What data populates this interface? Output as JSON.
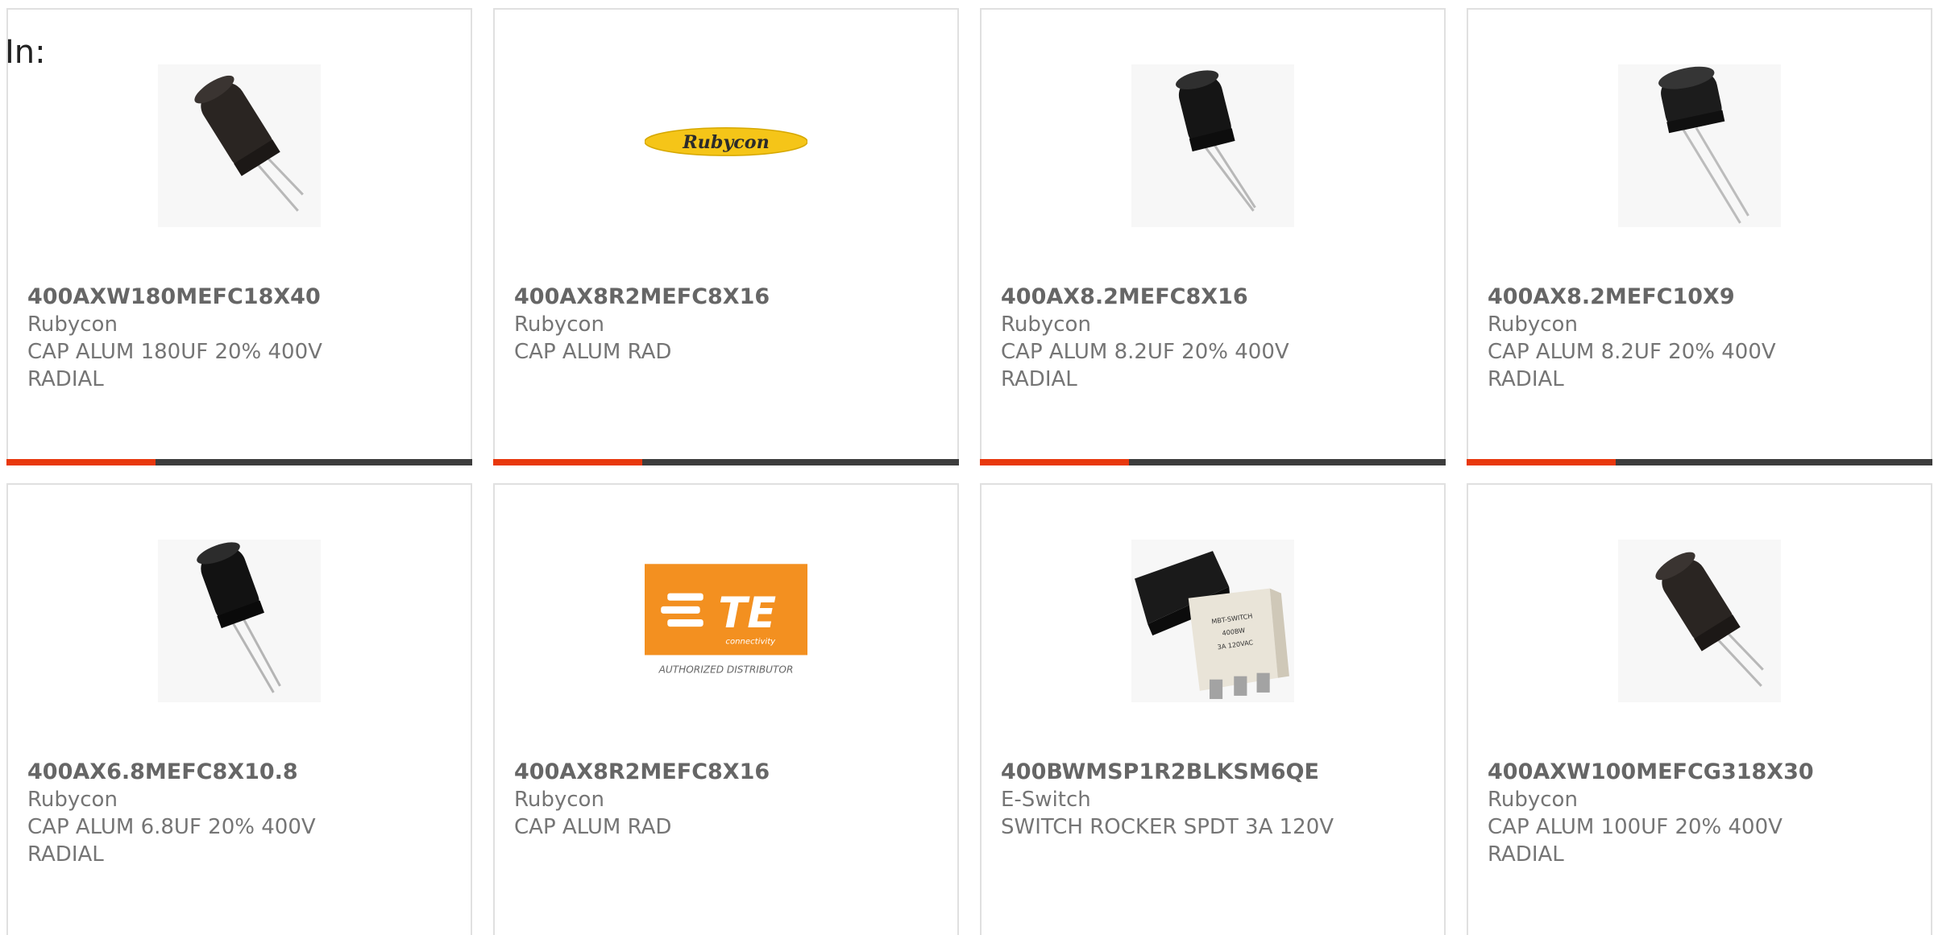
{
  "header": {
    "label": "In:"
  },
  "products": [
    {
      "part": "400AXW180MEFC18X40",
      "maker": "Rubycon",
      "desc1": "CAP ALUM 180UF 20% 400V",
      "desc2": "RADIAL",
      "image": "capacitor-tilted-icon"
    },
    {
      "part": "400AX8R2MEFC8X16",
      "maker": "Rubycon",
      "desc1": "CAP ALUM RAD",
      "desc2": "",
      "image": "rubycon-logo"
    },
    {
      "part": "400AX8.2MEFC8X16",
      "maker": "Rubycon",
      "desc1": "CAP ALUM 8.2UF 20% 400V",
      "desc2": "RADIAL",
      "image": "capacitor-icon"
    },
    {
      "part": "400AX8.2MEFC10X9",
      "maker": "Rubycon",
      "desc1": "CAP ALUM 8.2UF 20% 400V",
      "desc2": "RADIAL",
      "image": "capacitor-short-icon"
    },
    {
      "part": "400AX6.8MEFC8X10.8",
      "maker": "Rubycon",
      "desc1": "CAP ALUM 6.8UF 20% 400V",
      "desc2": "RADIAL",
      "image": "capacitor-icon"
    },
    {
      "part": "400AX8R2MEFC8X16",
      "maker": "Rubycon",
      "desc1": "CAP ALUM RAD",
      "desc2": "",
      "image": "te-connectivity-logo"
    },
    {
      "part": "400BWMSP1R2BLKSM6QE",
      "maker": "E-Switch",
      "desc1": "SWITCH ROCKER SPDT 3A 120V",
      "desc2": "",
      "image": "rocker-switch-icon"
    },
    {
      "part": "400AXW100MEFCG318X30",
      "maker": "Rubycon",
      "desc1": "CAP ALUM 100UF 20% 400V",
      "desc2": "RADIAL",
      "image": "capacitor-tilted-icon"
    }
  ],
  "logos": {
    "rubycon": "Rubycon",
    "te_mark": "TE",
    "te_sub": "connectivity",
    "te_caption": "AUTHORIZED DISTRIBUTOR",
    "switch_text_1": "MBT-SWITCH",
    "switch_text_2": "400BW",
    "switch_text_3": "3A 120VAC"
  },
  "colors": {
    "accent": "#e8380d",
    "bar": "#3d3d3d",
    "te_orange": "#f39020",
    "rubycon_yellow": "#f5c518"
  }
}
